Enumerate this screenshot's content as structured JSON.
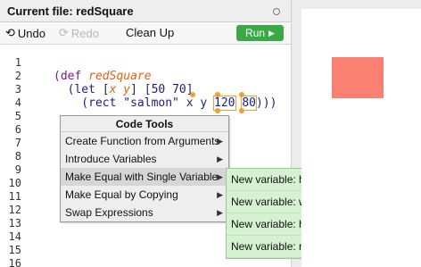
{
  "filebar": {
    "label": "Current file: redSquare"
  },
  "toolbar": {
    "undo": "Undo",
    "redo": "Redo",
    "cleanup": "Clean Up",
    "run": "Run"
  },
  "gutter": {
    "lines": [
      "1",
      "2",
      "3",
      "4",
      "5",
      "6",
      "7",
      "8",
      "9",
      "10",
      "11",
      "12",
      "13",
      "14",
      "15",
      "16"
    ]
  },
  "code": {
    "l2_open": "(def ",
    "l2_name": "redSquare",
    "l3_let": "  (let [",
    "l3_x": "x",
    "l3_sp": " ",
    "l3_y": "y",
    "l3_vals": "] [50 70]",
    "l4_pre": "    (rect \"salmon\" x y ",
    "l4_a": "120",
    "l4_sp": " ",
    "l4_b": "80",
    "l4_post": ")))"
  },
  "menu": {
    "title": "Code Tools",
    "items": [
      {
        "label": "Create Function from Arguments"
      },
      {
        "label": "Introduce Variables"
      },
      {
        "label": "Make Equal with Single Variable"
      },
      {
        "label": "Make Equal by Copying"
      },
      {
        "label": "Swap Expressions"
      }
    ]
  },
  "submenu": {
    "items": [
      {
        "label": "New variable: h"
      },
      {
        "label": "New variable: w"
      },
      {
        "label": "New variable: h_w"
      },
      {
        "label": "New variable: num"
      }
    ]
  },
  "canvas": {
    "shape_color": "#fa8072"
  }
}
